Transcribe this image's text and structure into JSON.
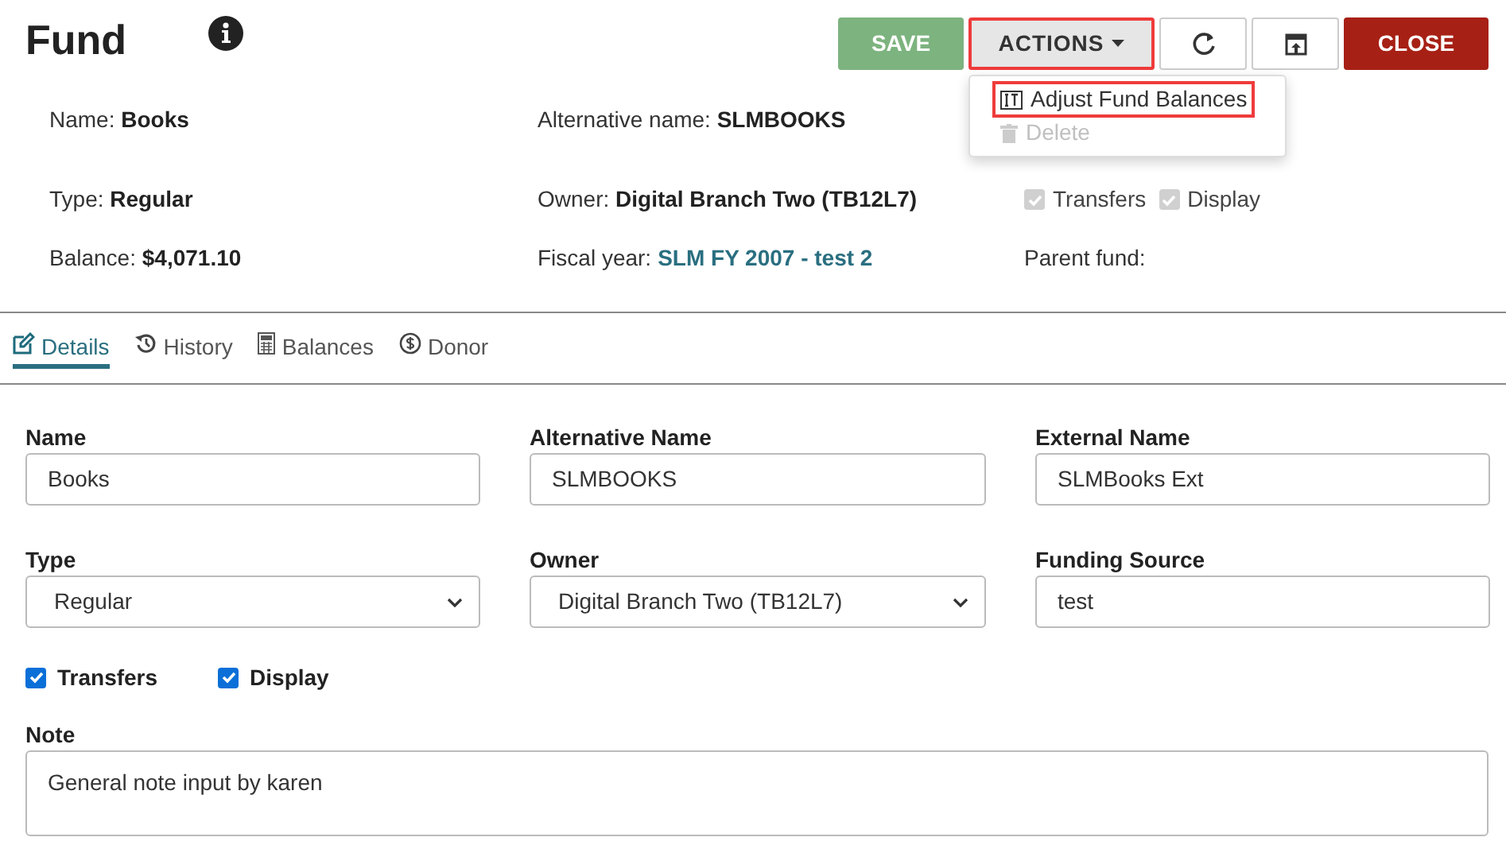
{
  "header": {
    "title": "Fund"
  },
  "toolbar": [
    {
      "kind": "save",
      "label": "SAVE"
    },
    {
      "kind": "actions",
      "label": "ACTIONS",
      "highlighted": true,
      "expanded": true
    },
    {
      "kind": "refresh"
    },
    {
      "kind": "export"
    },
    {
      "kind": "close",
      "label": "CLOSE"
    }
  ],
  "actions_menu": [
    {
      "kind": "adjust",
      "label": "Adjust Fund Balances",
      "highlighted": true,
      "disabled": false
    },
    {
      "kind": "delete",
      "label": "Delete",
      "highlighted": false,
      "disabled": true
    }
  ],
  "summary": [
    {
      "kind": "field",
      "label": "Name:",
      "value": "Books"
    },
    {
      "kind": "field",
      "label": "Alternative name:",
      "value": "SLMBOOKS"
    },
    {
      "kind": "empty"
    },
    {
      "kind": "field",
      "label": "Type:",
      "value": "Regular"
    },
    {
      "kind": "field",
      "label": "Owner:",
      "value": "Digital Branch Two (TB12L7)"
    },
    {
      "kind": "checks",
      "items": [
        {
          "label": "Transfers",
          "checked": true
        },
        {
          "label": "Display",
          "checked": true
        }
      ]
    },
    {
      "kind": "field",
      "label": "Balance:",
      "value": "$4,071.10"
    },
    {
      "kind": "link",
      "label": "Fiscal year:",
      "value": "SLM FY 2007 - test 2"
    },
    {
      "kind": "field",
      "label": "Parent fund:"
    }
  ],
  "tabs": [
    {
      "kind": "details",
      "label": "Details",
      "selected": true
    },
    {
      "kind": "history",
      "label": "History",
      "selected": false
    },
    {
      "kind": "balances",
      "label": "Balances",
      "selected": false
    },
    {
      "kind": "donor",
      "label": "Donor",
      "selected": false
    }
  ],
  "form": [
    {
      "kind": "input",
      "label": "Name",
      "value": "Books"
    },
    {
      "kind": "input",
      "label": "Alternative Name",
      "value": "SLMBOOKS"
    },
    {
      "kind": "input",
      "label": "External Name",
      "value": "SLMBooks Ext"
    },
    {
      "kind": "select",
      "label": "Type",
      "value": "Regular"
    },
    {
      "kind": "select",
      "label": "Owner",
      "value": "Digital Branch Two (TB12L7)"
    },
    {
      "kind": "input",
      "label": "Funding Source",
      "value": "test"
    }
  ],
  "checkboxes": [
    {
      "label": "Transfers",
      "checked": true
    },
    {
      "label": "Display",
      "checked": true
    }
  ],
  "note": {
    "label": "Note",
    "value": "General note input by karen"
  }
}
